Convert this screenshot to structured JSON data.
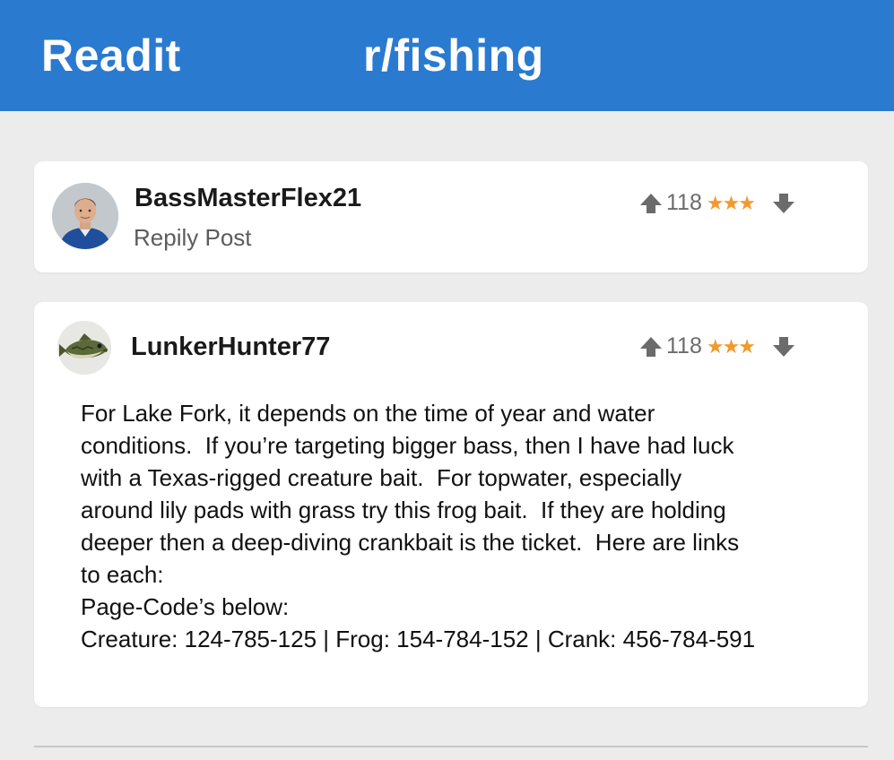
{
  "header": {
    "app_name": "Readit",
    "subreddit": "r/fishing"
  },
  "colors": {
    "header_background": "#2a7ad0",
    "page_background": "#ececec",
    "star_color": "#f2992e"
  },
  "comments": [
    {
      "username": "BassMasterFlex21",
      "subtext": "Repily Post",
      "avatar_icon": "man-portrait-avatar",
      "votes": "118",
      "stars": "★★★"
    },
    {
      "username": "LunkerHunter77",
      "avatar_icon": "largemouth-bass-avatar",
      "votes": "118",
      "stars": "★★★",
      "body_lines": [
        "For Lake Fork, it depends on the time of year and water",
        "conditions.  If you’re targeting bigger bass, then I have had luck",
        "with a Texas-rigged creature bait.  For topwater, especially",
        "around lily pads with grass try this frog bait.  If they are holding",
        "deeper then a deep-diving crankbait is the ticket.  Here are links",
        "to each:",
        "Page-Code’s below:",
        "Creature: 124-785-125 | Frog: 154-784-152 | Crank: 456-784-591"
      ]
    }
  ]
}
